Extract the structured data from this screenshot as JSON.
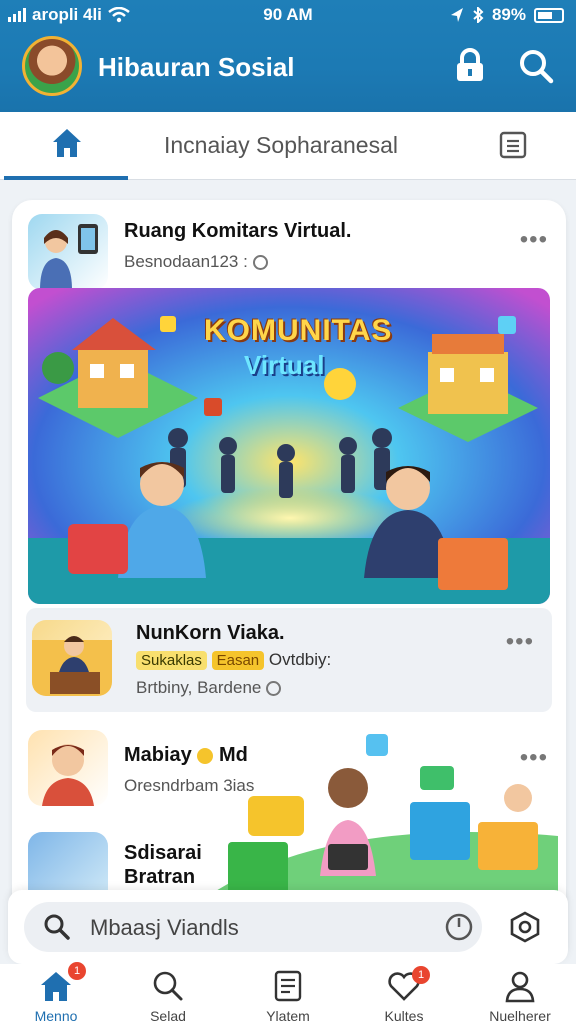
{
  "status": {
    "carrier": "aropli 4li",
    "time": "90 AM",
    "battery": "89%"
  },
  "header": {
    "title": "Hibauran Sosial"
  },
  "tabs": {
    "active_label": "Incnaiay Sopharanesal"
  },
  "posts": [
    {
      "title": "Ruang Komitars Virtual.",
      "subtitle": "Besnodaan123 :"
    },
    {
      "title": "NunKorn Viaka.",
      "badge_left": "Sukaklas",
      "badge": "Easan",
      "meta": "Ovtdbiy:",
      "subtitle": "Brtbiny, Bardene"
    },
    {
      "title": "Mabiay",
      "title_suffix": "Md",
      "subtitle": "Oresndrbam 3ias"
    },
    {
      "title": "Sdisarai",
      "subtitle": "Bratran"
    }
  ],
  "banner": {
    "title": "KOMUNITAS",
    "subtitle": "Virtual"
  },
  "search": {
    "placeholder": "Mbaasj Viandls"
  },
  "nav": [
    {
      "label": "Menno",
      "badge": "1"
    },
    {
      "label": "Selad"
    },
    {
      "label": "Ylatem"
    },
    {
      "label": "Kultes",
      "badge": "1"
    },
    {
      "label": "Nuelherer"
    }
  ],
  "colors": {
    "primary": "#1f7fb8",
    "accent": "#1f6fb0",
    "badge": "#f5c42c",
    "notification": "#e9452f"
  }
}
